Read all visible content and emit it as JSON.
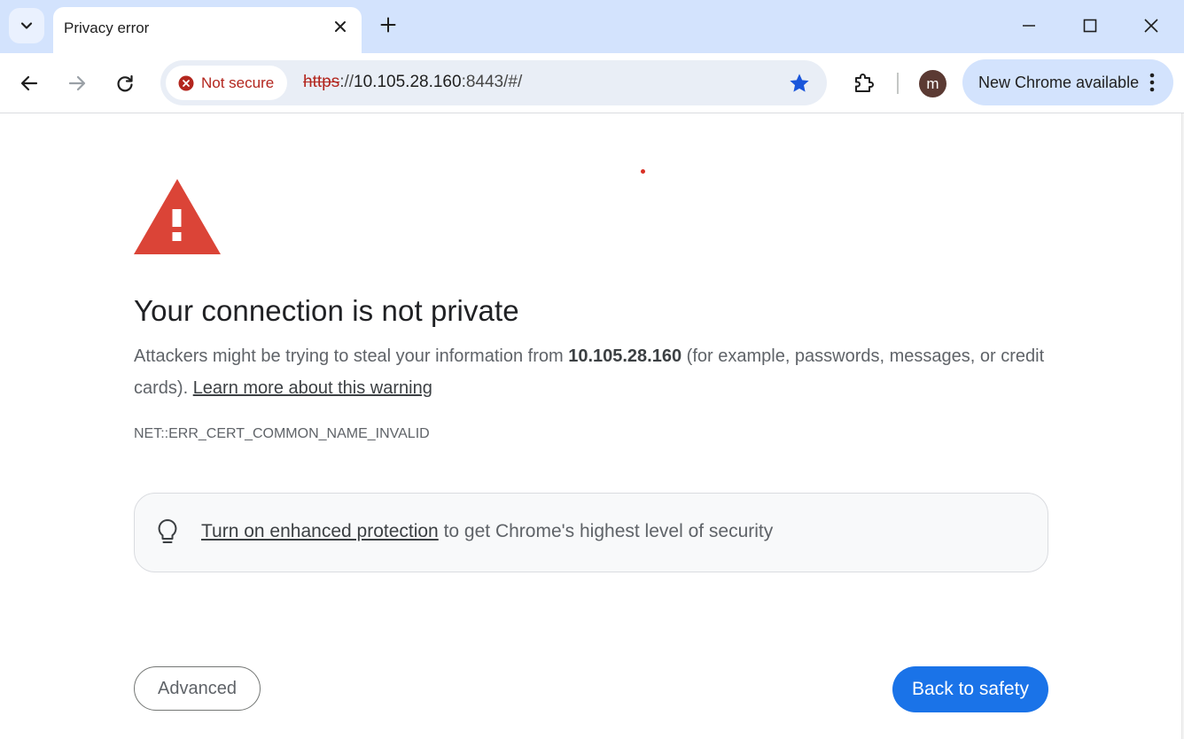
{
  "tabstrip": {
    "tab_title": "Privacy error"
  },
  "toolbar": {
    "security_chip_label": "Not secure",
    "url_scheme": "https",
    "url_separator": "://",
    "url_host": "10.105.28.160",
    "url_path": ":8443/#/",
    "avatar_letter": "m",
    "update_label": "New Chrome available"
  },
  "page": {
    "heading": "Your connection is not private",
    "explain_prefix": "Attackers might be trying to steal your information from ",
    "explain_host": "10.105.28.160",
    "explain_suffix": " (for example, passwords, messages, or credit cards). ",
    "learn_more": "Learn more about this warning",
    "error_code": "NET::ERR_CERT_COMMON_NAME_INVALID",
    "enhanced_link": "Turn on enhanced protection",
    "enhanced_suffix": " to get Chrome's highest level of security",
    "advanced_label": "Advanced",
    "back_label": "Back to safety"
  },
  "colors": {
    "tabstrip_bg": "#d3e3fd",
    "omnibox_bg": "#e9eef6",
    "not_secure_red": "#b3261e",
    "warning_red": "#db4437",
    "primary_blue": "#1a73e8",
    "avatar_bg": "#5b3a33"
  },
  "icons": {
    "tab_search": "chevron-down-icon",
    "tab_close": "close-icon",
    "new_tab": "plus-icon",
    "minimize": "minimize-icon",
    "maximize": "maximize-icon",
    "close_window": "close-icon",
    "back": "arrow-left-icon",
    "forward": "arrow-right-icon",
    "reload": "reload-icon",
    "not_secure": "error-circle-icon",
    "bookmark": "star-icon",
    "extensions": "puzzle-icon",
    "menu": "kebab-icon",
    "warning": "warning-triangle-icon",
    "enhanced": "lightbulb-icon"
  }
}
